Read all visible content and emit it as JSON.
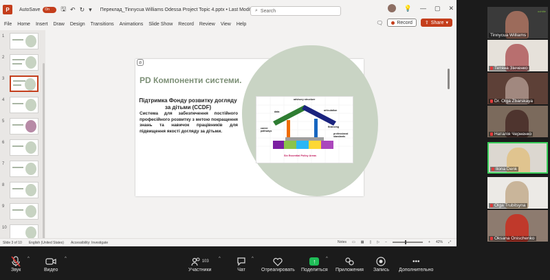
{
  "ppt": {
    "app_letter": "P",
    "autosave_label": "AutoSave",
    "autosave_state": "On",
    "doc_title": "Переклад_Tinnycua Williams Odessa Project Topic 4.pptx • Last Modified: 38m ago ∨",
    "search_placeholder": "Search",
    "menu": [
      "File",
      "Home",
      "Insert",
      "Draw",
      "Design",
      "Transitions",
      "Animations",
      "Slide Show",
      "Record",
      "Review",
      "View",
      "Help"
    ],
    "record_label": "Record",
    "share_label": "Share",
    "thumb_numbers": [
      "1",
      "2",
      "3",
      "4",
      "5",
      "6",
      "7",
      "8",
      "9",
      "10"
    ],
    "selected_thumb": 3
  },
  "slide": {
    "title": "PD Компоненти системи.",
    "subtitle": "Підтримка Фонду розвитку догляду за дітьми (CCDF)",
    "body": "Система для забезпечення постійного професійного розвитку з метою покращення знань та навичок працівників для підвищення якості догляду за дітьми.",
    "diagram": {
      "top_label": "advisory structure",
      "labels": [
        "data",
        "articulation",
        "career pathways",
        "financing",
        "professional standards"
      ],
      "caption": "Six Essential Policy Areas"
    }
  },
  "status": {
    "slide_of": "Slide 3 of 10",
    "language": "English (United States)",
    "accessibility": "Accessibility: Investigate",
    "notes": "Notes",
    "zoom": "42%"
  },
  "participants": [
    {
      "name": "Tinnycua Williams",
      "muted": false,
      "speaking": false
    },
    {
      "name": "Тетяна Зінченко",
      "muted": true,
      "speaking": false
    },
    {
      "name": "Dr. Olga Zbarskaya",
      "muted": true,
      "speaking": false
    },
    {
      "name": "Наталія Черненко",
      "muted": true,
      "speaking": false
    },
    {
      "name": "Ilona Denk",
      "muted": true,
      "speaking": true
    },
    {
      "name": "Olga Trubitsyna",
      "muted": true,
      "speaking": false
    },
    {
      "name": "Oksana Onischenko",
      "muted": true,
      "speaking": false
    }
  ],
  "participant_tile_badge": "ouhttle",
  "zoom_toolbar": {
    "audio": "Звук",
    "video": "Видео",
    "participants_count": "103",
    "participants": "Участники",
    "chat": "Чат",
    "react": "Отреагировать",
    "share": "Поделиться",
    "apps": "Приложения",
    "record": "Запись",
    "more": "Дополнительно"
  },
  "colors": {
    "accent": "#c43e1c",
    "slide_title": "#7c8f76",
    "blob": "#c9d4c4",
    "share_green": "#1fbd57",
    "speaking_border": "#3ad05b"
  }
}
